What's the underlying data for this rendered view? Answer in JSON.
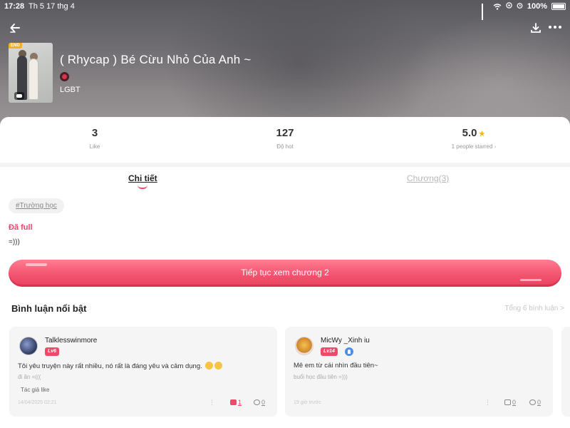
{
  "statusbar": {
    "time": "17:28",
    "date": "Th 5 17 thg 4",
    "battery": "100%"
  },
  "book": {
    "title": "( Rhycap ) Bé Cừu Nhỏ Của Anh ~",
    "genre": "LGBT",
    "end_badge": "END"
  },
  "stats": {
    "likes": "3",
    "likes_label": "Like",
    "hot": "127",
    "hot_label": "Độ hot",
    "rating": "5.0",
    "rating_label": "1 people starred",
    "rating_chevron": "›"
  },
  "tabs": [
    {
      "label": "Chi tiết"
    },
    {
      "label": "Chương(3)"
    }
  ],
  "detail": {
    "tag": "#Trường học",
    "status": "Đã full",
    "description": "=)))"
  },
  "continue_button": "Tiếp tục xem chương 2",
  "comments_section": {
    "title": "Bình luận nổi bật",
    "total": "Tổng 6 bình luận >",
    "items": [
      {
        "username": "Talklesswinmore",
        "level": "Lv6",
        "text": "Tôi yêu truyện này rất nhiều, nó rất là đáng yêu và cảm dụng.",
        "reply": "đi ăn =(((",
        "author_like": "Tác giả like",
        "time": "14/04/2025 02:21",
        "more": "⋮",
        "likes": "1",
        "replies": "0"
      },
      {
        "username": "MicWy _Xinh iu",
        "level": "Lv14",
        "text": "Mê em từ cái nhìn đầu tiên~",
        "reply": "buổi học đầu tiên =)))",
        "time": "19 giờ trước",
        "more": "⋮",
        "likes": "0",
        "replies": "0"
      }
    ]
  },
  "colors": {
    "accent": "#ef4a6a",
    "star": "#f6b21b"
  }
}
